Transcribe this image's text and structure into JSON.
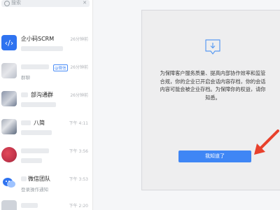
{
  "search": {
    "placeholder": "搜索"
  },
  "conversations": [
    {
      "title": "企小码SCRM",
      "subtitle": "",
      "time": "26分钟前",
      "badge": ""
    },
    {
      "title": "",
      "subtitle": "群聊",
      "time": "26分钟前",
      "badge": "@微信"
    },
    {
      "title": "部沟通群",
      "subtitle": "",
      "time": "26分钟前",
      "badge": ""
    },
    {
      "title": "八简",
      "subtitle": "",
      "time": "下午 4:11",
      "badge": ""
    },
    {
      "title": "",
      "subtitle": "",
      "time": "下午 3:56",
      "badge": ""
    },
    {
      "title": "微信团队",
      "subtitle": "登录操作通知",
      "time": "下午 3:53",
      "badge": ""
    },
    {
      "title": "",
      "subtitle": "",
      "time": "下午 2:20",
      "badge": ""
    }
  ],
  "dialog": {
    "message": "为保障客户服务质量、提高内部协作效率和监管合规，你的企业已开启会话内容存档，你的会话内容可能会被企业存档。为保障你的权益，请你知悉。",
    "confirm_label": "我知道了"
  },
  "colors": {
    "accent": "#3f86f5",
    "arrow": "#e8412c"
  },
  "icons": {
    "download": "download-icon",
    "arrow": "red-arrow-icon"
  }
}
